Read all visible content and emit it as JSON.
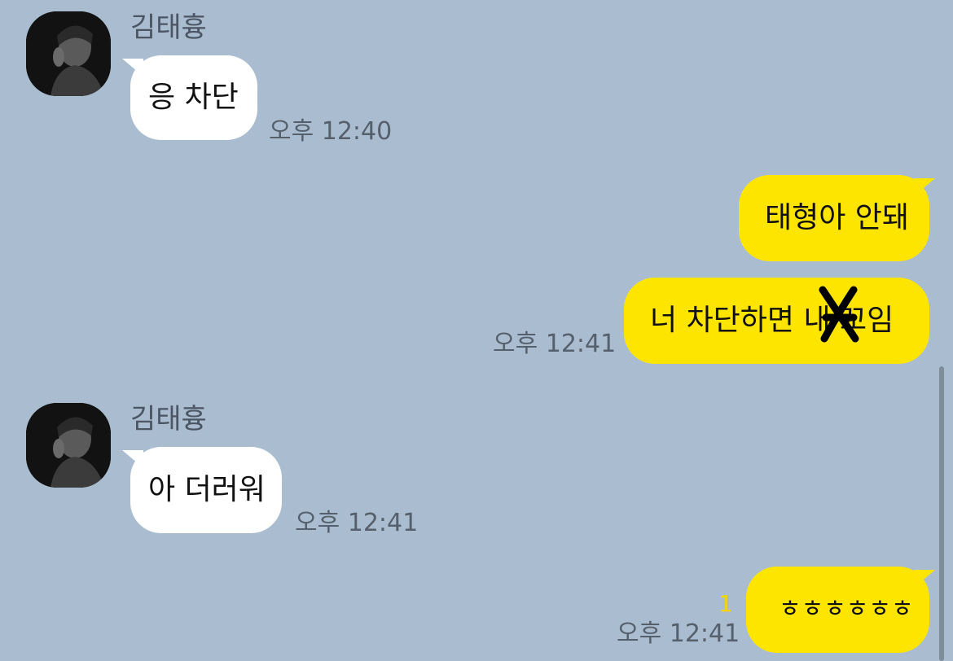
{
  "colors": {
    "background": "#aabdd0",
    "incoming_bubble": "#ffffff",
    "outgoing_bubble": "#fee500",
    "unread_count": "#f5d400"
  },
  "messages": [
    {
      "direction": "incoming",
      "sender": "김태흉",
      "avatar": "profile-photo",
      "text": "응 차단",
      "time": "오후 12:40"
    },
    {
      "direction": "outgoing",
      "text": "태형아 안돼"
    },
    {
      "direction": "outgoing",
      "text": "너 차단하면 내  꼬임",
      "time": "오후 12:41",
      "annotation": "scribble-mark"
    },
    {
      "direction": "incoming",
      "sender": "김태흉",
      "avatar": "profile-photo",
      "text": "아 더러워",
      "time": "오후 12:41"
    },
    {
      "direction": "outgoing",
      "text": "ㅎㅎㅎㅎㅎㅎ",
      "time": "오후 12:41",
      "unread_count": "1"
    }
  ]
}
